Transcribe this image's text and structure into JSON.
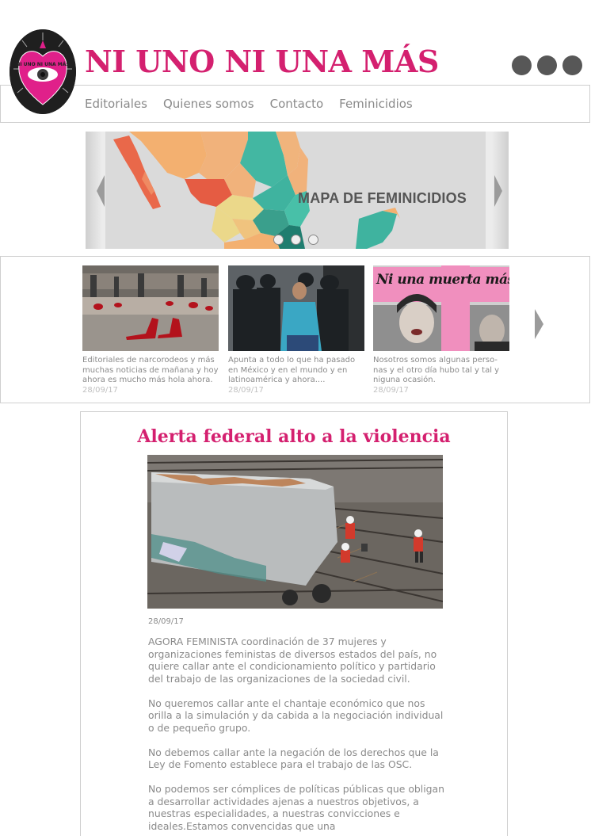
{
  "header": {
    "logo_text": "NI UNO NI UNA MÁS",
    "site_title": "NI UNO NI UNA MÁS",
    "menu_icon": "more-dots-icon"
  },
  "nav": {
    "items": [
      {
        "label": "Editoriales"
      },
      {
        "label": "Quienes somos"
      },
      {
        "label": "Contacto"
      },
      {
        "label": "Feminicidios"
      }
    ]
  },
  "hero": {
    "caption": "MAPA DE FEMINICIDIOS",
    "slide_count": 3
  },
  "news": {
    "cards": [
      {
        "text": "Editoriales de narcorodeos y más muchas noticias de mañana y hoy ahora es mucho más hola ahora.",
        "date": "28/09/17"
      },
      {
        "text": "Apunta a todo lo que ha pasado en México y en el mundo y en latinoamérica y ahora....",
        "date": "28/09/17"
      },
      {
        "text": "Nosotros somos algunas perso-nas y el otro día hubo tal y tal y niguna ocasión.",
        "date": "28/09/17",
        "sign_text": "Ni una muerta más"
      }
    ]
  },
  "article": {
    "title": "Alerta federal alto a la violencia",
    "date": "28/09/17",
    "paragraphs": [
      "AGORA FEMINISTA coordinación de 37 mujeres y organizaciones feministas de diversos estados del país, no quiere callar ante el condicionamiento político y partidario del trabajo de las organizaciones de la sociedad civil.",
      "No queremos callar ante el chantaje económico que nos orilla a la simulación y da cabida a la negociación individual o de pequeño grupo.",
      "No debemos callar ante la negación de los derechos que la Ley de Fomento establece para el trabajo de las OSC.",
      "No podemos ser cómplices de políticas públicas que obligan a desarrollar actividades ajenas a nuestros objetivos, a nuestras especialidades, a nuestras convicciones e ideales.Estamos convencidas que una"
    ]
  },
  "colors": {
    "brand": "#d4206f",
    "text": "#8a8a8a",
    "border": "#cfcfcf",
    "dots": "#575757"
  }
}
